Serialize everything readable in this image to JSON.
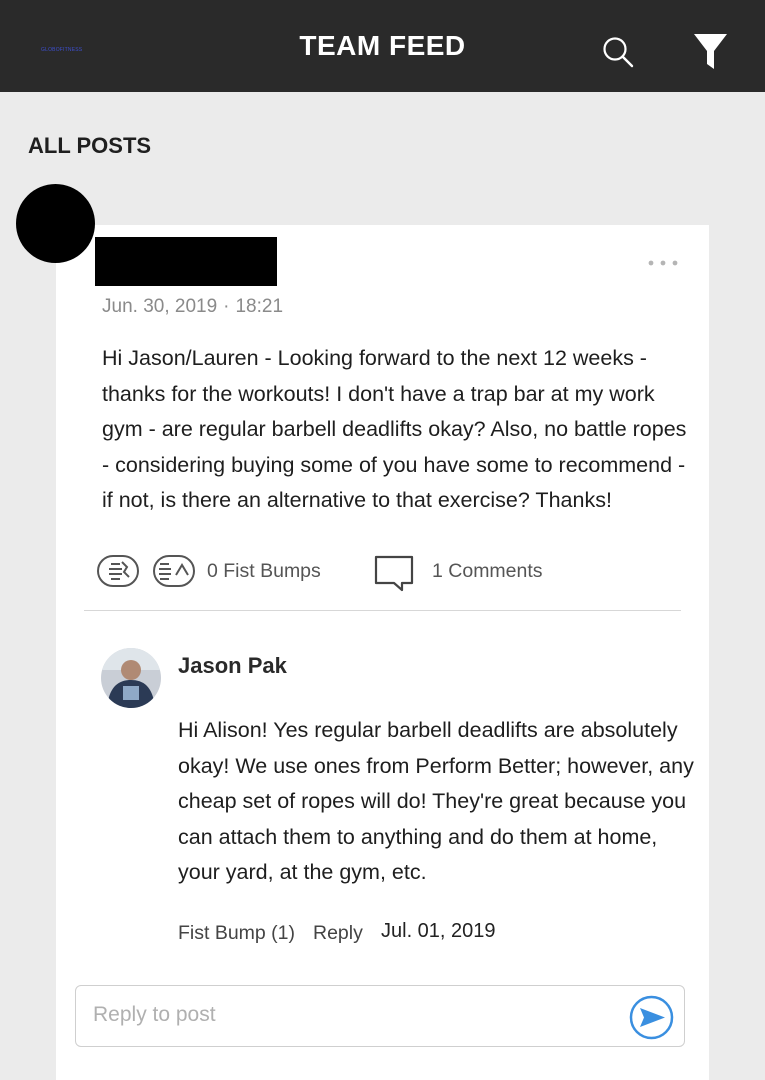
{
  "header": {
    "logo_text": "GLOBOFITNESS",
    "title": "TEAM FEED",
    "search_icon": "search-icon",
    "filter_icon": "filter-icon",
    "background": "#2a2a2a"
  },
  "section": {
    "title": "ALL POSTS"
  },
  "post": {
    "date": "Jun. 30, 2019",
    "separator": "·",
    "time": "18:21",
    "body": "Hi Jason/Lauren - Looking forward to the next 12 weeks - thanks for the workouts! I don't have a trap bar at my work gym - are regular barbell deadlifts okay? Also, no battle ropes - considering buying some of you have some to recommend - if not, is there an alternative to that exercise? Thanks!",
    "fist_bumps_label": "0 Fist Bumps",
    "comments_label": "1 Comments"
  },
  "reply": {
    "name": "Jason Pak",
    "body": "Hi Alison! Yes regular barbell deadlifts are absolutely okay! We use ones from Perform Better; however, any cheap set of ropes will do! They're great because you can attach them to anything and do them at home, your yard, at the gym, etc.",
    "fist_bump_label": "Fist Bump (1)",
    "reply_label": "Reply",
    "date": "Jul. 01, 2019"
  },
  "composer": {
    "placeholder": "Reply to post",
    "send_color": "#3a8fe0"
  }
}
